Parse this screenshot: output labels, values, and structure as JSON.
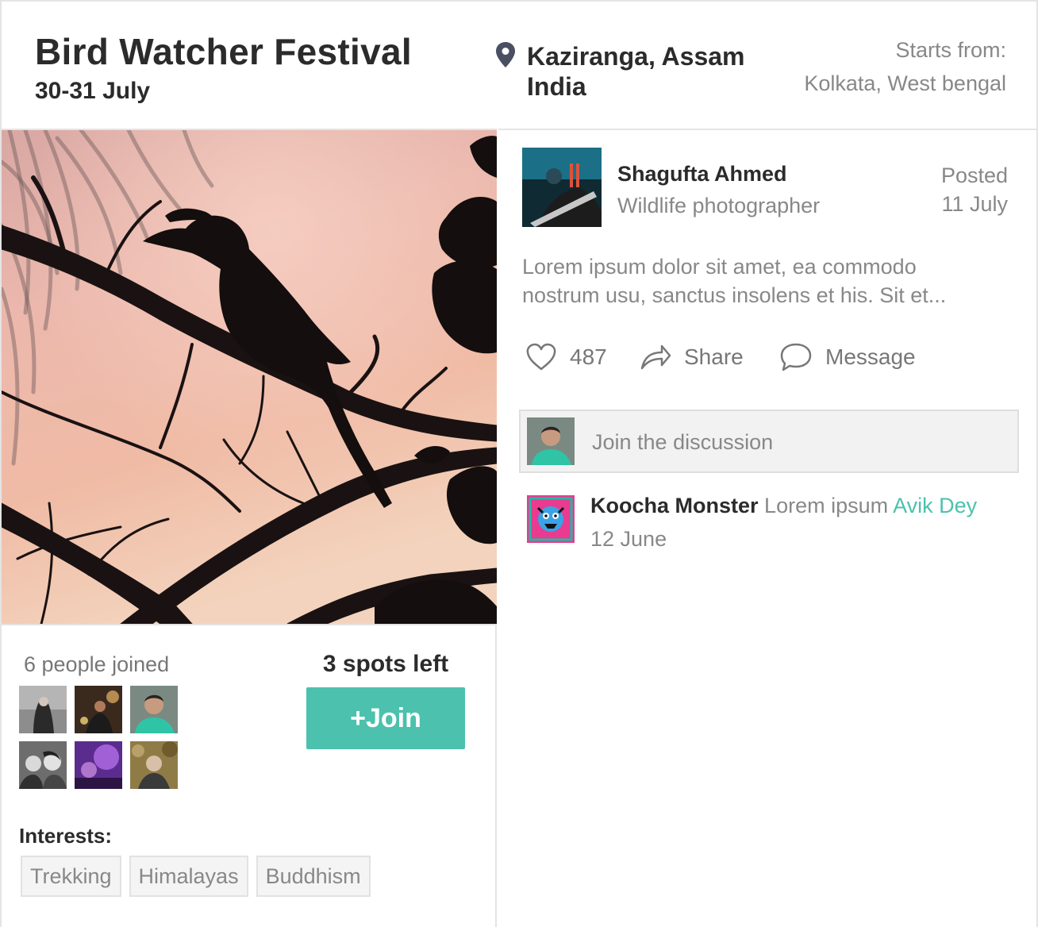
{
  "event": {
    "title": "Bird Watcher Festival",
    "date": "30-31 July",
    "location_line1": "Kaziranga, Assam",
    "location_line2": "India",
    "starts_label": "Starts from:",
    "starts_value": "Kolkata, West bengal"
  },
  "participants": {
    "joined_label": "6 people joined",
    "spots_left": "3 spots left",
    "join_label": "+Join"
  },
  "interests": {
    "label": "Interests:",
    "tags": [
      "Trekking",
      "Himalayas",
      "Buddhism"
    ]
  },
  "post": {
    "author_name": "Shagufta Ahmed",
    "author_role": "Wildlife photographer",
    "posted_label": "Posted",
    "posted_date": "11 July",
    "text": "Lorem ipsum dolor sit amet, ea commodo nostrum usu, sanctus insolens et his. Sit et...",
    "likes": "487",
    "share_label": "Share",
    "message_label": "Message"
  },
  "discussion": {
    "placeholder": "Join the discussion"
  },
  "comment": {
    "author": "Koocha Monster",
    "text": "Lorem ipsum",
    "mention": "Avik Dey",
    "date": "12 June"
  },
  "colors": {
    "accent": "#4cc1ad",
    "text_dark": "#2b2b2b",
    "text_muted": "#888888",
    "pin": "#4a4f63"
  },
  "icons": {
    "location": "map-pin-icon",
    "like": "heart-icon",
    "share": "share-arrow-icon",
    "message": "speech-bubble-icon"
  }
}
